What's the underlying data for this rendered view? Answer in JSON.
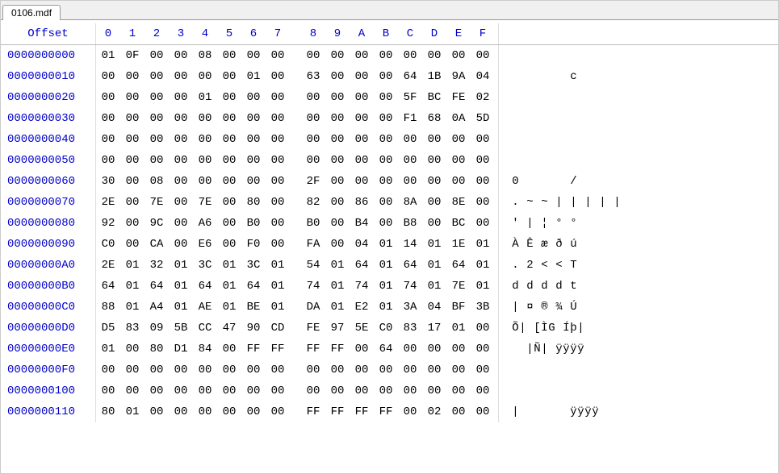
{
  "tab": {
    "label": "0106.mdf"
  },
  "header": {
    "offset_label": "Offset",
    "cols": [
      "0",
      "1",
      "2",
      "3",
      "4",
      "5",
      "6",
      "7",
      "8",
      "9",
      "A",
      "B",
      "C",
      "D",
      "E",
      "F"
    ]
  },
  "rows": [
    {
      "offset": "0000000000",
      "hex": [
        "01",
        "0F",
        "00",
        "00",
        "08",
        "00",
        "00",
        "00",
        "00",
        "00",
        "00",
        "00",
        "00",
        "00",
        "00",
        "00"
      ],
      "ascii": [
        "",
        "",
        "",
        "",
        "",
        "",
        "",
        "",
        "",
        "",
        "",
        "",
        "",
        "",
        "",
        ""
      ]
    },
    {
      "offset": "0000000010",
      "hex": [
        "00",
        "00",
        "00",
        "00",
        "00",
        "00",
        "01",
        "00",
        "63",
        "00",
        "00",
        "00",
        "64",
        "1B",
        "9A",
        "04"
      ],
      "ascii": [
        "",
        "",
        "",
        "",
        "",
        "",
        "",
        "",
        "c",
        "",
        "",
        "",
        "",
        "",
        "",
        ""
      ]
    },
    {
      "offset": "0000000020",
      "hex": [
        "00",
        "00",
        "00",
        "00",
        "01",
        "00",
        "00",
        "00",
        "00",
        "00",
        "00",
        "00",
        "5F",
        "BC",
        "FE",
        "02"
      ],
      "ascii": [
        "",
        "",
        "",
        "",
        "",
        "",
        "",
        "",
        "",
        "",
        "",
        "",
        "",
        "",
        "",
        ""
      ]
    },
    {
      "offset": "0000000030",
      "hex": [
        "00",
        "00",
        "00",
        "00",
        "00",
        "00",
        "00",
        "00",
        "00",
        "00",
        "00",
        "00",
        "F1",
        "68",
        "0A",
        "5D"
      ],
      "ascii": [
        "",
        "",
        "",
        "",
        "",
        "",
        "",
        "",
        "",
        "",
        "",
        "",
        "",
        "",
        "",
        ""
      ]
    },
    {
      "offset": "0000000040",
      "hex": [
        "00",
        "00",
        "00",
        "00",
        "00",
        "00",
        "00",
        "00",
        "00",
        "00",
        "00",
        "00",
        "00",
        "00",
        "00",
        "00"
      ],
      "ascii": [
        "",
        "",
        "",
        "",
        "",
        "",
        "",
        "",
        "",
        "",
        "",
        "",
        "",
        "",
        "",
        ""
      ]
    },
    {
      "offset": "0000000050",
      "hex": [
        "00",
        "00",
        "00",
        "00",
        "00",
        "00",
        "00",
        "00",
        "00",
        "00",
        "00",
        "00",
        "00",
        "00",
        "00",
        "00"
      ],
      "ascii": [
        "",
        "",
        "",
        "",
        "",
        "",
        "",
        "",
        "",
        "",
        "",
        "",
        "",
        "",
        "",
        ""
      ]
    },
    {
      "offset": "0000000060",
      "hex": [
        "30",
        "00",
        "08",
        "00",
        "00",
        "00",
        "00",
        "00",
        "2F",
        "00",
        "00",
        "00",
        "00",
        "00",
        "00",
        "00"
      ],
      "ascii": [
        "0",
        "",
        "",
        "",
        "",
        "",
        "",
        "",
        "/",
        "",
        "",
        "",
        "",
        "",
        "",
        ""
      ]
    },
    {
      "offset": "0000000070",
      "hex": [
        "2E",
        "00",
        "7E",
        "00",
        "7E",
        "00",
        "80",
        "00",
        "82",
        "00",
        "86",
        "00",
        "8A",
        "00",
        "8E",
        "00"
      ],
      "ascii": [
        ".",
        "",
        "~",
        "",
        "~",
        "",
        "|",
        "",
        "|",
        "",
        "|",
        "",
        "|",
        "",
        "|",
        ""
      ]
    },
    {
      "offset": "0000000080",
      "hex": [
        "92",
        "00",
        "9C",
        "00",
        "A6",
        "00",
        "B0",
        "00",
        "B0",
        "00",
        "B4",
        "00",
        "B8",
        "00",
        "BC",
        "00"
      ],
      "ascii": [
        "'",
        "",
        "|",
        "",
        "¦",
        "",
        "°",
        "",
        "°",
        "",
        "",
        "",
        "",
        "",
        "",
        ""
      ]
    },
    {
      "offset": "0000000090",
      "hex": [
        "C0",
        "00",
        "CA",
        "00",
        "E6",
        "00",
        "F0",
        "00",
        "FA",
        "00",
        "04",
        "01",
        "14",
        "01",
        "1E",
        "01"
      ],
      "ascii": [
        "À",
        "",
        "Ê",
        "",
        "æ",
        "",
        "ð",
        "",
        "ú",
        "",
        "",
        "",
        "",
        "",
        "",
        ""
      ]
    },
    {
      "offset": "00000000A0",
      "hex": [
        "2E",
        "01",
        "32",
        "01",
        "3C",
        "01",
        "3C",
        "01",
        "54",
        "01",
        "64",
        "01",
        "64",
        "01",
        "64",
        "01"
      ],
      "ascii": [
        ".",
        "",
        "2",
        "",
        "<",
        "",
        "<",
        "",
        "T",
        "",
        "",
        "",
        "",
        "",
        "",
        ""
      ]
    },
    {
      "offset": "00000000B0",
      "hex": [
        "64",
        "01",
        "64",
        "01",
        "64",
        "01",
        "64",
        "01",
        "74",
        "01",
        "74",
        "01",
        "74",
        "01",
        "7E",
        "01"
      ],
      "ascii": [
        "d",
        "",
        "d",
        "",
        "d",
        "",
        "d",
        "",
        "t",
        "",
        "",
        "",
        "",
        "",
        "",
        ""
      ]
    },
    {
      "offset": "00000000C0",
      "hex": [
        "88",
        "01",
        "A4",
        "01",
        "AE",
        "01",
        "BE",
        "01",
        "DA",
        "01",
        "E2",
        "01",
        "3A",
        "04",
        "BF",
        "3B"
      ],
      "ascii": [
        "|",
        "",
        "¤",
        "",
        "®",
        "",
        "¾",
        "",
        "Ú",
        "",
        "",
        "",
        "",
        "",
        "",
        ""
      ]
    },
    {
      "offset": "00000000D0",
      "hex": [
        "D5",
        "83",
        "09",
        "5B",
        "CC",
        "47",
        "90",
        "CD",
        "FE",
        "97",
        "5E",
        "C0",
        "83",
        "17",
        "01",
        "00"
      ],
      "ascii": [
        "Õ",
        "|",
        "",
        "[",
        "Ì",
        "G",
        "",
        "Í",
        "þ",
        "|",
        "",
        "",
        "",
        "",
        "",
        ""
      ]
    },
    {
      "offset": "00000000E0",
      "hex": [
        "01",
        "00",
        "80",
        "D1",
        "84",
        "00",
        "FF",
        "FF",
        "FF",
        "FF",
        "00",
        "64",
        "00",
        "00",
        "00",
        "00"
      ],
      "ascii": [
        "",
        "",
        "|",
        "Ñ",
        "|",
        "",
        "ÿ",
        "ÿ",
        "ÿ",
        "ÿ",
        "",
        "",
        "",
        "",
        "",
        ""
      ]
    },
    {
      "offset": "00000000F0",
      "hex": [
        "00",
        "00",
        "00",
        "00",
        "00",
        "00",
        "00",
        "00",
        "00",
        "00",
        "00",
        "00",
        "00",
        "00",
        "00",
        "00"
      ],
      "ascii": [
        "",
        "",
        "",
        "",
        "",
        "",
        "",
        "",
        "",
        "",
        "",
        "",
        "",
        "",
        "",
        ""
      ]
    },
    {
      "offset": "0000000100",
      "hex": [
        "00",
        "00",
        "00",
        "00",
        "00",
        "00",
        "00",
        "00",
        "00",
        "00",
        "00",
        "00",
        "00",
        "00",
        "00",
        "00"
      ],
      "ascii": [
        "",
        "",
        "",
        "",
        "",
        "",
        "",
        "",
        "",
        "",
        "",
        "",
        "",
        "",
        "",
        ""
      ]
    },
    {
      "offset": "0000000110",
      "hex": [
        "80",
        "01",
        "00",
        "00",
        "00",
        "00",
        "00",
        "00",
        "FF",
        "FF",
        "FF",
        "FF",
        "00",
        "02",
        "00",
        "00"
      ],
      "ascii": [
        "|",
        "",
        "",
        "",
        "",
        "",
        "",
        "",
        "ÿ",
        "ÿ",
        "ÿ",
        "ÿ",
        "",
        "",
        "",
        ""
      ]
    }
  ]
}
